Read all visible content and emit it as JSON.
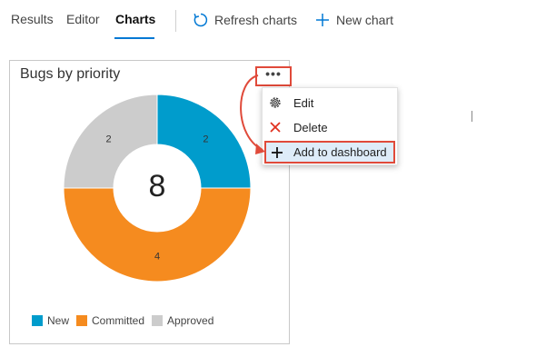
{
  "tabs": [
    {
      "label": "Results"
    },
    {
      "label": "Editor"
    },
    {
      "label": "Charts",
      "active": true
    }
  ],
  "toolbar": {
    "refresh_label": "Refresh charts",
    "refresh_icon": "refresh-icon",
    "new_chart_label": "New chart",
    "new_chart_icon": "plus-icon"
  },
  "card": {
    "title": "Bugs by priority",
    "more_icon": "more-actions-icon"
  },
  "menu": {
    "items": [
      {
        "label": "Edit",
        "icon": "gear-icon"
      },
      {
        "label": "Delete",
        "icon": "close-icon"
      },
      {
        "label": "Add to dashboard",
        "icon": "plus-icon"
      }
    ]
  },
  "colors": {
    "accent": "#0078d4",
    "highlight": "#e04a3a",
    "new": "#009ccc",
    "committed": "#f58b1f",
    "approved": "#cccccc"
  },
  "chart_data": {
    "type": "pie",
    "donut": true,
    "total": "8",
    "categories": [
      "New",
      "Committed",
      "Approved"
    ],
    "values": [
      2,
      4,
      2
    ],
    "value_labels": [
      "2",
      "4",
      "2"
    ],
    "colors": [
      "#009ccc",
      "#f58b1f",
      "#cccccc"
    ],
    "legend_position": "bottom"
  }
}
